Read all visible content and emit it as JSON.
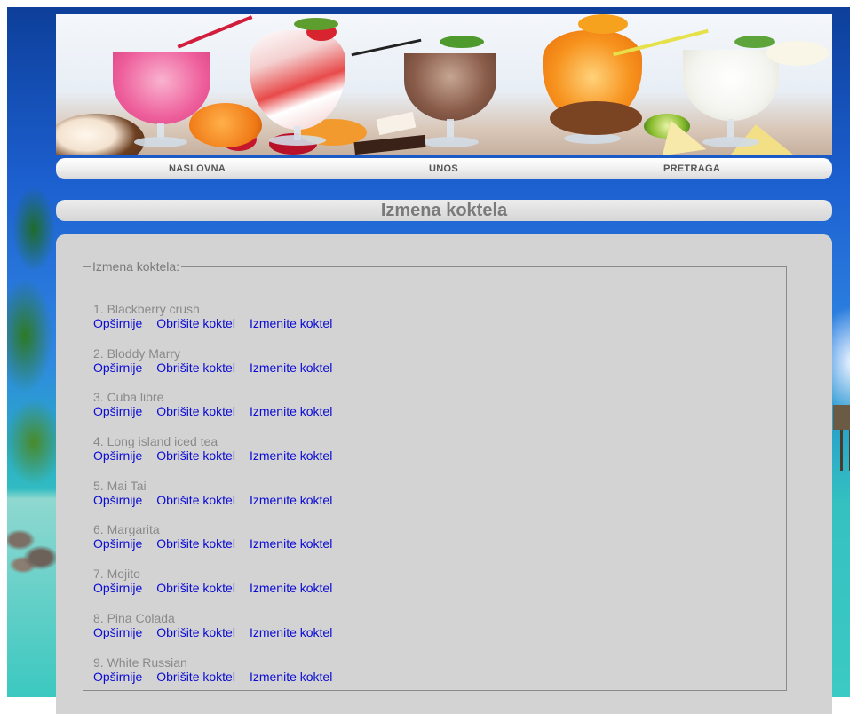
{
  "nav": {
    "items": [
      "NASLOVNA",
      "UNOS",
      "PRETRAGA"
    ]
  },
  "page": {
    "title": "Izmena koktela",
    "legend": "Izmena koktela:"
  },
  "cocktails": [
    {
      "name": "1. Blackberry crush"
    },
    {
      "name": "2. Bloddy Marry"
    },
    {
      "name": "3. Cuba libre"
    },
    {
      "name": "4. Long island iced tea"
    },
    {
      "name": "5. Mai Tai"
    },
    {
      "name": "6. Margarita"
    },
    {
      "name": "7. Mojito"
    },
    {
      "name": "8. Pina Colada"
    },
    {
      "name": "9. White Russian"
    }
  ],
  "actions": {
    "more": "Opširnije",
    "delete": "Obrišite koktel",
    "edit": "Izmenite koktel"
  },
  "colors": {
    "link": "#0b0bd4",
    "muted_text": "#8a8a8a",
    "panel": "#d3d3d3"
  }
}
